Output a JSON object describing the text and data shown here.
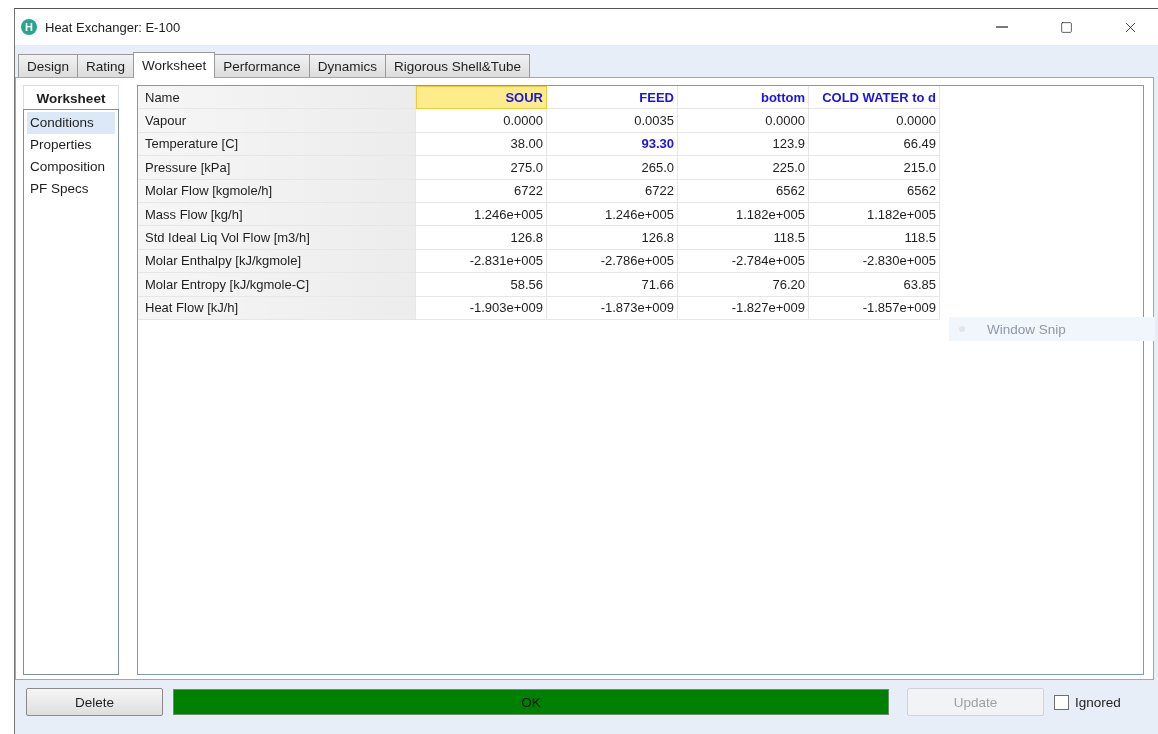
{
  "window": {
    "icon_text": "H",
    "title": "Heat Exchanger: E-100"
  },
  "tabs": [
    {
      "label": "Design",
      "selected": false
    },
    {
      "label": "Rating",
      "selected": false
    },
    {
      "label": "Worksheet",
      "selected": true
    },
    {
      "label": "Performance",
      "selected": false
    },
    {
      "label": "Dynamics",
      "selected": false
    },
    {
      "label": "Rigorous Shell&Tube",
      "selected": false
    }
  ],
  "side_panel": {
    "title": "Worksheet",
    "items": [
      {
        "label": "Conditions",
        "selected": true
      },
      {
        "label": "Properties",
        "selected": false
      },
      {
        "label": "Composition",
        "selected": false
      },
      {
        "label": "PF Specs",
        "selected": false
      }
    ]
  },
  "table": {
    "header_label": "Name",
    "columns": [
      {
        "label": "SOUR",
        "selected": true
      },
      {
        "label": "FEED",
        "selected": false
      },
      {
        "label": "bottom",
        "selected": false
      },
      {
        "label": "COLD WATER to d",
        "selected": false
      }
    ],
    "rows": [
      {
        "label": "Vapour",
        "cells": [
          {
            "value": "0.0000",
            "specified": false
          },
          {
            "value": "0.0035",
            "specified": false
          },
          {
            "value": "0.0000",
            "specified": false
          },
          {
            "value": "0.0000",
            "specified": false
          }
        ]
      },
      {
        "label": "Temperature [C]",
        "cells": [
          {
            "value": "38.00",
            "specified": false
          },
          {
            "value": "93.30",
            "specified": true
          },
          {
            "value": "123.9",
            "specified": false
          },
          {
            "value": "66.49",
            "specified": false
          }
        ]
      },
      {
        "label": "Pressure [kPa]",
        "cells": [
          {
            "value": "275.0",
            "specified": false
          },
          {
            "value": "265.0",
            "specified": false
          },
          {
            "value": "225.0",
            "specified": false
          },
          {
            "value": "215.0",
            "specified": false
          }
        ]
      },
      {
        "label": "Molar Flow [kgmole/h]",
        "cells": [
          {
            "value": "6722",
            "specified": false
          },
          {
            "value": "6722",
            "specified": false
          },
          {
            "value": "6562",
            "specified": false
          },
          {
            "value": "6562",
            "specified": false
          }
        ]
      },
      {
        "label": "Mass Flow [kg/h]",
        "cells": [
          {
            "value": "1.246e+005",
            "specified": false
          },
          {
            "value": "1.246e+005",
            "specified": false
          },
          {
            "value": "1.182e+005",
            "specified": false
          },
          {
            "value": "1.182e+005",
            "specified": false
          }
        ]
      },
      {
        "label": "Std Ideal Liq Vol Flow [m3/h]",
        "cells": [
          {
            "value": "126.8",
            "specified": false
          },
          {
            "value": "126.8",
            "specified": false
          },
          {
            "value": "118.5",
            "specified": false
          },
          {
            "value": "118.5",
            "specified": false
          }
        ]
      },
      {
        "label": "Molar Enthalpy [kJ/kgmole]",
        "cells": [
          {
            "value": "-2.831e+005",
            "specified": false
          },
          {
            "value": "-2.786e+005",
            "specified": false
          },
          {
            "value": "-2.784e+005",
            "specified": false
          },
          {
            "value": "-2.830e+005",
            "specified": false
          }
        ]
      },
      {
        "label": "Molar Entropy [kJ/kgmole-C]",
        "cells": [
          {
            "value": "58.56",
            "specified": false
          },
          {
            "value": "71.66",
            "specified": false
          },
          {
            "value": "76.20",
            "specified": false
          },
          {
            "value": "63.85",
            "specified": false
          }
        ]
      },
      {
        "label": "Heat Flow [kJ/h]",
        "cells": [
          {
            "value": "-1.903e+009",
            "specified": false
          },
          {
            "value": "-1.873e+009",
            "specified": false
          },
          {
            "value": "-1.827e+009",
            "specified": false
          },
          {
            "value": "-1.857e+009",
            "specified": false
          }
        ]
      }
    ]
  },
  "tooltip": {
    "text": "Window Snip"
  },
  "footer": {
    "delete_label": "Delete",
    "status": "OK",
    "update": {
      "label": "Update",
      "disabled": true
    },
    "ignored": {
      "label": "Ignored",
      "checked": false
    }
  }
}
